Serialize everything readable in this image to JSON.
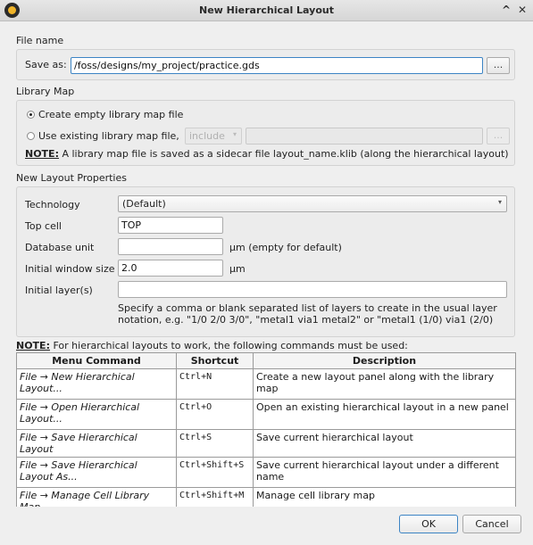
{
  "window": {
    "title": "New Hierarchical Layout"
  },
  "file_name": {
    "section": "File name",
    "save_as_label": "Save as:",
    "save_as_value": "/foss/designs/my_project/practice.gds",
    "browse_label": "..."
  },
  "library_map": {
    "section": "Library Map",
    "option_empty": "Create empty library map file",
    "option_existing": "Use existing library map file,",
    "mode_value": "include",
    "browse_label": "...",
    "note_label": "NOTE:",
    "note_text": " A library map file is saved as a sidecar file layout_name.klib (along the hierarchical layout)"
  },
  "properties": {
    "section": "New Layout Properties",
    "technology_label": "Technology",
    "technology_value": "(Default)",
    "top_cell_label": "Top cell",
    "top_cell_value": "TOP",
    "db_unit_label": "Database unit",
    "db_unit_value": "",
    "db_unit_suffix": "µm  (empty for default)",
    "window_size_label": "Initial window size",
    "window_size_value": "2.0",
    "window_size_suffix": "µm",
    "layers_label": "Initial layer(s)",
    "layers_value": "",
    "layers_help": "Specify a comma or blank separated list of layers to create in the usual layer notation, e.g. \"1/0 2/0 3/0\", \"metal1 via1 metal2\" or \"metal1 (1/0) via1 (2/0)"
  },
  "commands": {
    "note_label": "NOTE:",
    "note_text": " For hierarchical layouts to work, the following commands must be used:",
    "headers": [
      "Menu Command",
      "Shortcut",
      "Description"
    ],
    "rows": [
      {
        "command": "File → New Hierarchical Layout...",
        "shortcut": "Ctrl+N",
        "description": "Create a new layout panel along with the library map"
      },
      {
        "command": "File → Open Hierarchical Layout...",
        "shortcut": "Ctrl+O",
        "description": "Open an existing hierarchical layout in a new panel"
      },
      {
        "command": "File → Save Hierarchical Layout",
        "shortcut": "Ctrl+S",
        "description": "Save current hierarchical layout"
      },
      {
        "command": "File → Save Hierarchical Layout As...",
        "shortcut": "Ctrl+Shift+S",
        "description": "Save current hierarchical layout under a different name"
      },
      {
        "command": "File → Manage Cell Library Map...",
        "shortcut": "Ctrl+Shift+M",
        "description": "Manage cell library map"
      }
    ]
  },
  "buttons": {
    "ok": "OK",
    "cancel": "Cancel"
  }
}
